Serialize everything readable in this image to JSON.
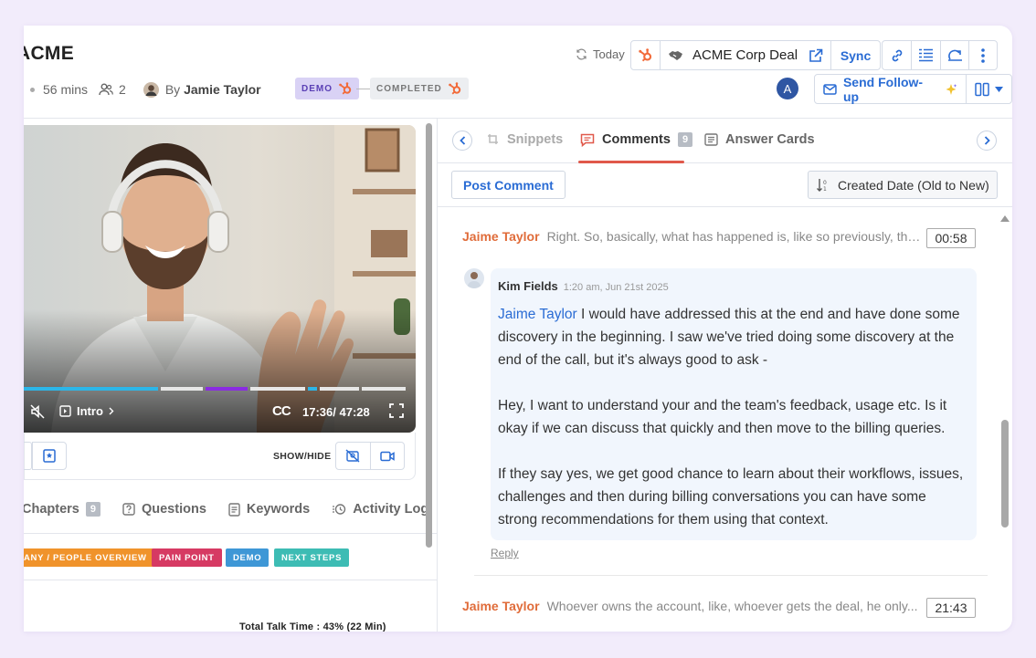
{
  "header": {
    "title": "ACME",
    "duration": "56 mins",
    "participants": "2",
    "by_prefix": "By",
    "by_name": "Jamie Taylor",
    "badges": [
      {
        "label": "DEMO",
        "bg": "#d9d2f5",
        "fg": "#5a3fb5"
      },
      {
        "label": "COMPLETED",
        "bg": "#eceef1",
        "fg": "#777777"
      }
    ],
    "today_label": "Today",
    "deal_name": "ACME Corp Deal",
    "sync_label": "Sync",
    "avatar_letter": "A",
    "send_followup_label": "Send Follow-up"
  },
  "video": {
    "chapter_label": "Intro",
    "time_current": "17:36/",
    "time_total": "47:28",
    "cc_label": "CC",
    "show_hide_label": "SHOW/HIDE",
    "progress": 0.37
  },
  "left_tabs": [
    {
      "label": "Chapters",
      "count": "9"
    },
    {
      "label": "Questions"
    },
    {
      "label": "Keywords"
    },
    {
      "label": "Activity Log"
    }
  ],
  "tags": [
    {
      "label": "ANY / PEOPLE OVERVIEW",
      "color": "#f0932b"
    },
    {
      "label": "PAIN POINT",
      "color": "#d63a63"
    },
    {
      "label": "DEMO",
      "color": "#3e97d6"
    },
    {
      "label": "NEXT STEPS",
      "color": "#3dbcb4"
    }
  ],
  "talk_time": "Total Talk Time : 43% (22 Min)",
  "right_tabs": {
    "snippets": "Snippets",
    "comments": "Comments",
    "comments_count": "9",
    "answer_cards": "Answer Cards"
  },
  "actions": {
    "post_comment": "Post Comment",
    "sort_label": "Created Date (Old to New)"
  },
  "comments": [
    {
      "author": "Jaime Taylor",
      "text": "Right. So, basically, what has happened is, like so previously, the...",
      "time": "00:58"
    },
    {
      "author": "Jaime Taylor",
      "text": "Whoever owns the account, like, whoever gets the deal, he only...",
      "time": "21:43"
    }
  ],
  "reply": {
    "author": "Kim Fields",
    "date": "1:20 am, Jun 21st 2025",
    "mention": "Jaime Taylor",
    "p1": " I would have addressed this at the end and have done some discovery in the beginning. I saw we've tried doing some discovery at the end of the call, but it's always good to ask -",
    "p2": "Hey, I want to  understand  your and the team's feedback, usage etc. Is it okay if we can discuss that quickly and then move to the billing queries.",
    "p3": "If they say yes, we get good chance to learn about their workflows, issues, challenges and then during billing conversations you can have some strong recommendations for them using that context.",
    "reply_label": "Reply"
  },
  "colors": {
    "accent": "#2a6cd4",
    "hubspot": "#f26b3a",
    "name_orange": "#e06c3a"
  }
}
